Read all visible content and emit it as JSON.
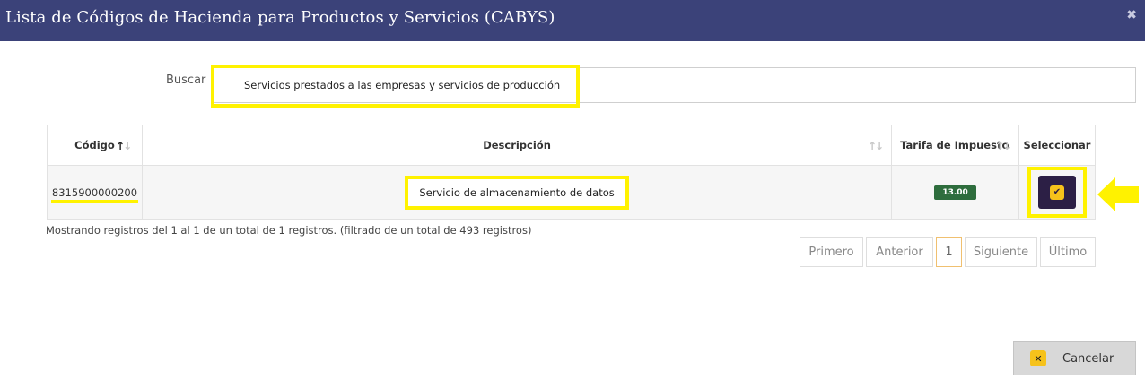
{
  "modal": {
    "title": "Lista de Códigos de Hacienda para Productos y Servicios (CABYS)",
    "close_icon": "✖"
  },
  "search": {
    "label": "Buscar",
    "value": "Servicios prestados a las empresas y servicios de producción"
  },
  "table": {
    "columns": [
      "Código",
      "Descripción",
      "Tarifa de Impuesto",
      "Seleccionar"
    ],
    "rows": [
      {
        "code": "8315900000200",
        "description": "Servicio de almacenamiento de datos",
        "rate": "13.00"
      }
    ]
  },
  "info": "Mostrando registros del 1 al 1 de un total de 1 registros. (filtrado de un total de 493 registros)",
  "pagination": {
    "first": "Primero",
    "prev": "Anterior",
    "current": "1",
    "next": "Siguiente",
    "last": "Último"
  },
  "footer": {
    "cancel_label": "Cancelar"
  },
  "colors": {
    "header_bg": "#3b4279",
    "highlight": "#fff200",
    "select_button": "#2c1f45",
    "accent_yellow": "#f6c21b",
    "rate_badge": "#2e6d3d"
  },
  "icons": {
    "close": "close-icon",
    "sort": "sort-arrows-icon",
    "select": "checkmark-icon",
    "pointer": "arrow-left-icon",
    "cancel": "x-icon"
  }
}
